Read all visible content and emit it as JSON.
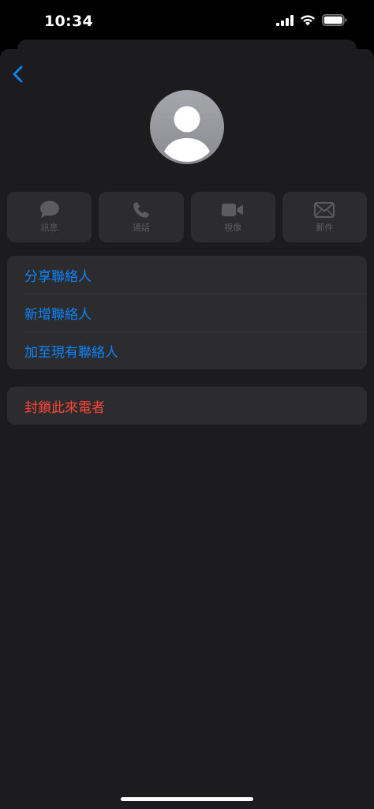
{
  "status_bar": {
    "time": "10:34"
  },
  "nav": {
    "back_icon": "chevron-left-icon"
  },
  "avatar": {
    "icon": "person-silhouette-icon"
  },
  "actions": [
    {
      "label": "訊息",
      "icon": "message-bubble-icon"
    },
    {
      "label": "通話",
      "icon": "phone-icon"
    },
    {
      "label": "視像",
      "icon": "video-camera-icon"
    },
    {
      "label": "郵件",
      "icon": "envelope-icon"
    }
  ],
  "contact_options": [
    {
      "label": "分享聯絡人"
    },
    {
      "label": "新增聯絡人"
    },
    {
      "label": "加至現有聯絡人"
    }
  ],
  "block_option": {
    "label": "封鎖此來電者"
  },
  "colors": {
    "background": "#1c1c1e",
    "cell": "#2c2c2e",
    "accent_blue": "#0a84ff",
    "destructive_red": "#ff453a",
    "disabled_gray": "#5b5b60"
  }
}
